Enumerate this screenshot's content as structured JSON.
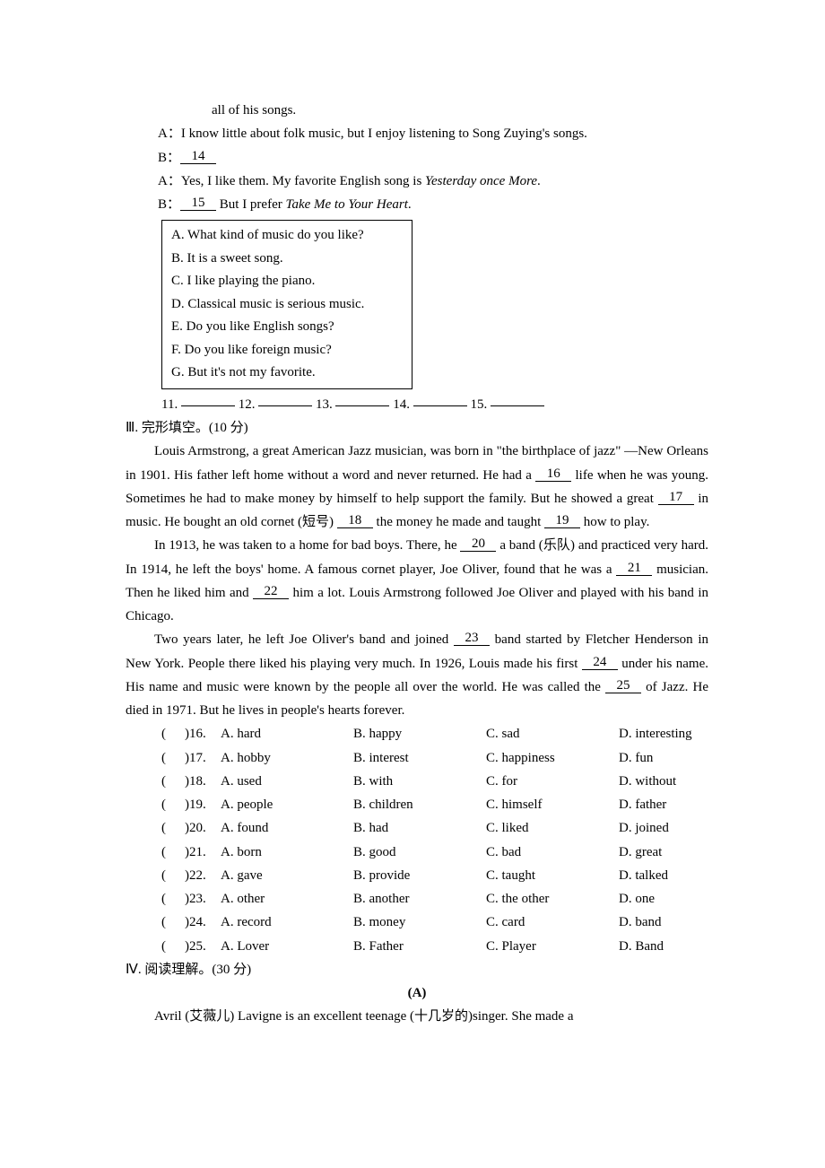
{
  "dialog": {
    "continuation": "all of his songs.",
    "a1": "A：I know little about folk music, but I enjoy listening to Song Zuying's songs.",
    "b1_prefix": "B：",
    "b1_blank": "14",
    "a2_prefix": "A：Yes, I like them. My favorite English song is ",
    "a2_italic": "Yesterday once More",
    "a2_suffix": ".",
    "b2_prefix": "B：",
    "b2_blank": "15",
    "b2_mid": " But I prefer ",
    "b2_italic": "Take Me to Your Heart",
    "b2_suffix": "."
  },
  "optionsBox": {
    "a": "A. What kind of music do you like?",
    "b": "B. It is a sweet song.",
    "c": "C. I like playing the piano.",
    "d": "D. Classical music is serious music.",
    "e": "E. Do you like English songs?",
    "f": "F. Do you like foreign music?",
    "g": "G. But it's not my favorite."
  },
  "answersRow": {
    "n11": "11. ",
    "n12": " 12. ",
    "n13": " 13. ",
    "n14": " 14. ",
    "n15": " 15. "
  },
  "section3": {
    "title": "Ⅲ. 完形填空。(10 分)",
    "para1_a": "Louis Armstrong, a great American Jazz musician, was born in \"the birthplace of jazz\" —New Orleans in 1901. His father left home without a word and never returned. He had a ",
    "b16": "16",
    "para1_b": " life when he was young. Sometimes he had to make money by himself to help support the family. But he showed a great ",
    "b17": "17",
    "para1_c": " in music. He bought an old cornet (短号) ",
    "b18": "18",
    "para1_d": " the money he made and taught ",
    "b19": "19",
    "para1_e": " how to play.",
    "para2_a": "In 1913, he was taken to a home for bad boys. There, he ",
    "b20": "20",
    "para2_b": " a band (乐队) and practiced very hard. In 1914, he left the boys' home. A famous cornet player, Joe Oliver, found that he was a ",
    "b21": "21",
    "para2_c": " musician. Then he liked him and ",
    "b22": "22",
    "para2_d": " him a lot. Louis Armstrong followed Joe Oliver and played with his band in Chicago.",
    "para3_a": "Two years later, he left Joe Oliver's band and joined ",
    "b23": "23",
    "para3_b": " band started by Fletcher Henderson in New York. People there liked his playing very much. In 1926, Louis made his first ",
    "b24": "24",
    "para3_c": " under his name. His name and music were known by the people all over the world. He was called the ",
    "b25": "25",
    "para3_d": " of Jazz. He died in 1971. But he lives in people's hearts forever."
  },
  "cloze": {
    "rows": [
      {
        "num": ")16.",
        "a": "A. hard",
        "b": "B. happy",
        "c": "C. sad",
        "d": "D. interesting"
      },
      {
        "num": ")17.",
        "a": "A. hobby",
        "b": "B. interest",
        "c": "C. happiness",
        "d": "D. fun"
      },
      {
        "num": ")18.",
        "a": "A. used",
        "b": "B. with",
        "c": "C. for",
        "d": "D. without"
      },
      {
        "num": ")19.",
        "a": "A. people",
        "b": "B. children",
        "c": "C. himself",
        "d": "D. father"
      },
      {
        "num": ")20.",
        "a": "A. found",
        "b": "B. had",
        "c": "C. liked",
        "d": "D. joined"
      },
      {
        "num": ")21.",
        "a": "A. born",
        "b": "B. good",
        "c": "C. bad",
        "d": "D. great"
      },
      {
        "num": ")22.",
        "a": "A. gave",
        "b": "B. provide",
        "c": "C. taught",
        "d": "D. talked"
      },
      {
        "num": ")23.",
        "a": "A. other",
        "b": "B. another",
        "c": "C. the other",
        "d": "D. one"
      },
      {
        "num": ")24.",
        "a": "A. record",
        "b": "B. money",
        "c": "C. card",
        "d": "     D. band"
      },
      {
        "num": ")25.",
        "a": "A. Lover",
        "b": "B. Father",
        "c": "C. Player",
        "d": "D. Band"
      }
    ]
  },
  "section4": {
    "title": "Ⅳ. 阅读理解。(30 分)",
    "subtitle": "(A)",
    "para": "Avril (艾薇儿) Lavigne is an excellent teenage (十几岁的)singer. She made a"
  }
}
